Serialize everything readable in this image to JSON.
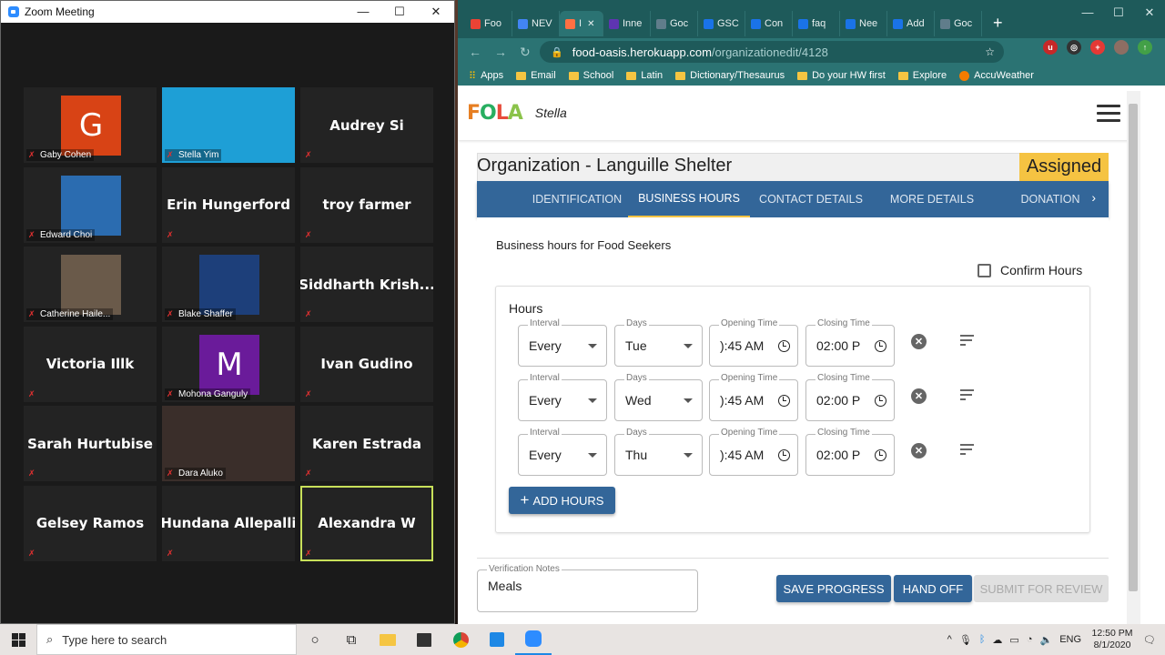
{
  "zoom": {
    "title": "Zoom Meeting",
    "participants": [
      {
        "name": "Gaby Cohen",
        "kind": "avatar",
        "initial": "G",
        "color": "#d84315"
      },
      {
        "name": "Stella Yim",
        "kind": "photo"
      },
      {
        "name": "Audrey Si",
        "kind": "name"
      },
      {
        "name": "Edward Choi",
        "kind": "photo"
      },
      {
        "name": "Erin Hungerford",
        "kind": "name"
      },
      {
        "name": "troy farmer",
        "kind": "name"
      },
      {
        "name": "Catherine Haile...",
        "kind": "photo"
      },
      {
        "name": "Blake Shaffer",
        "kind": "photo"
      },
      {
        "name": "Siddharth  Krish...",
        "kind": "name"
      },
      {
        "name": "Victoria Illk",
        "kind": "name"
      },
      {
        "name": "Mohona Ganguly",
        "kind": "avatar",
        "initial": "M",
        "color": "#6a1b9a"
      },
      {
        "name": "Ivan Gudino",
        "kind": "name"
      },
      {
        "name": "Sarah Hurtubise",
        "kind": "name"
      },
      {
        "name": "Dara Aluko",
        "kind": "photo"
      },
      {
        "name": "Karen Estrada",
        "kind": "name"
      },
      {
        "name": "Gelsey Ramos",
        "kind": "name"
      },
      {
        "name": "Hundana Allepalli",
        "kind": "name"
      },
      {
        "name": "Alexandra W",
        "kind": "name",
        "active": true
      }
    ]
  },
  "browser": {
    "tabs": [
      "Foo",
      "NEV",
      "I",
      "Inne",
      "Goc",
      "GSC",
      "Con",
      "faq",
      "Nee",
      "Add",
      "Goc"
    ],
    "url_host": "food-oasis.herokuapp.com",
    "url_path": "/organizationedit/4128",
    "bookmarks": [
      "Apps",
      "Email",
      "School",
      "Latin",
      "Dictionary/Thesaurus",
      "Do your HW first",
      "Explore",
      "AccuWeather"
    ]
  },
  "app": {
    "logo": "FOLA",
    "user": "Stella",
    "org_title": "Organization - Languille Shelter",
    "status_badge": "Assigned",
    "tabs": [
      "IDENTIFICATION",
      "BUSINESS HOURS",
      "CONTACT DETAILS",
      "MORE DETAILS",
      "DONATION"
    ],
    "selected_tab": "BUSINESS HOURS",
    "section_heading": "Business hours for Food Seekers",
    "confirm_label": "Confirm Hours",
    "hours_label": "Hours",
    "field_labels": {
      "interval": "Interval",
      "days": "Days",
      "open": "Opening Time",
      "close": "Closing Time"
    },
    "rows": [
      {
        "interval": "Every",
        "day": "Tue",
        "open": "):45 AM",
        "close": "02:00 P"
      },
      {
        "interval": "Every",
        "day": "Wed",
        "open": "):45 AM",
        "close": "02:00 P"
      },
      {
        "interval": "Every",
        "day": "Thu",
        "open": "):45 AM",
        "close": "02:00 P"
      }
    ],
    "add_hours": "ADD HOURS",
    "notes_label": "Verification Notes",
    "notes_value": "Meals",
    "save": "SAVE PROGRESS",
    "handoff": "HAND OFF",
    "submit": "SUBMIT FOR REVIEW"
  },
  "taskbar": {
    "search_placeholder": "Type here to search",
    "lang": "ENG",
    "time": "12:50 PM",
    "date": "8/1/2020"
  }
}
